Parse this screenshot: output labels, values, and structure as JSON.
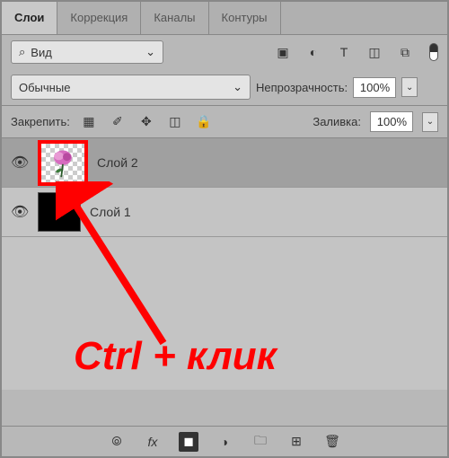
{
  "tabs": {
    "layers": "Слои",
    "adjustments": "Коррекция",
    "channels": "Каналы",
    "paths": "Контуры"
  },
  "view": {
    "label": "Вид"
  },
  "blend": {
    "mode": "Обычные"
  },
  "opacity": {
    "label": "Непрозрачность:",
    "value": "100%"
  },
  "lock": {
    "label": "Закрепить:"
  },
  "fill": {
    "label": "Заливка:",
    "value": "100%"
  },
  "layers": [
    {
      "name": "Слой 2"
    },
    {
      "name": "Слой 1"
    }
  ],
  "annotation": "Ctrl + клик",
  "icons": {
    "search": "⌕",
    "chevron": "⌄",
    "image": "▣",
    "circleHalf": "◐",
    "text": "T",
    "transform": "◫",
    "artboard": "⧉",
    "lockPixels": "▦",
    "brush": "✐",
    "move": "✥",
    "crop": "◫",
    "lock": "🔒",
    "link": "⦾",
    "fx": "fx",
    "mask": "◼",
    "adjustment": "◑",
    "group": "🗀",
    "newLayer": "⊞",
    "trash": "🗑"
  }
}
